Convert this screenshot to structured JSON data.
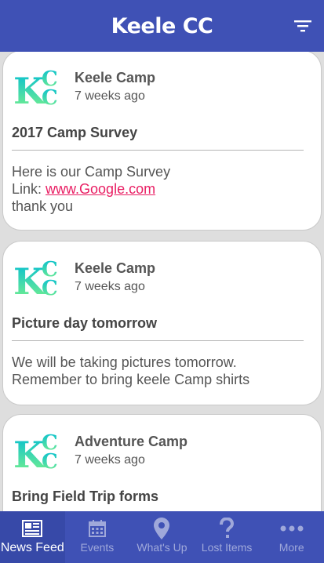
{
  "app": {
    "title": "Keele CC"
  },
  "posts": [
    {
      "logo_text": "KCC",
      "author": "Keele Camp",
      "time": "7 weeks ago",
      "title": "2017 Camp Survey",
      "body_line1": "Here is our Camp Survey",
      "link_prefix": "Link: ",
      "link_text": "www.Google.com",
      "body_line3": "thank you"
    },
    {
      "logo_text": "KCC",
      "author": "Keele Camp",
      "time": "7 weeks ago",
      "title": "Picture day tomorrow",
      "body_line1": "We will be taking pictures tomorrow.",
      "body_line2": "Remember to bring keele Camp shirts"
    },
    {
      "logo_text": "KCC",
      "author": "Adventure Camp",
      "time": "7 weeks ago",
      "title": "Bring Field Trip forms"
    }
  ],
  "tabs": [
    {
      "label": "News Feed",
      "icon": "newspaper-icon",
      "active": true
    },
    {
      "label": "Events",
      "icon": "calendar-icon",
      "active": false
    },
    {
      "label": "What's Up",
      "icon": "location-pin-icon",
      "active": false
    },
    {
      "label": "Lost Items",
      "icon": "question-mark-icon",
      "active": false
    },
    {
      "label": "More",
      "icon": "more-dots-icon",
      "active": false
    }
  ],
  "colors": {
    "primary": "#3f51b5",
    "link": "#e91e63",
    "logo_gradient_top": "#00bcd4",
    "logo_gradient_bottom": "#7cf28a"
  }
}
